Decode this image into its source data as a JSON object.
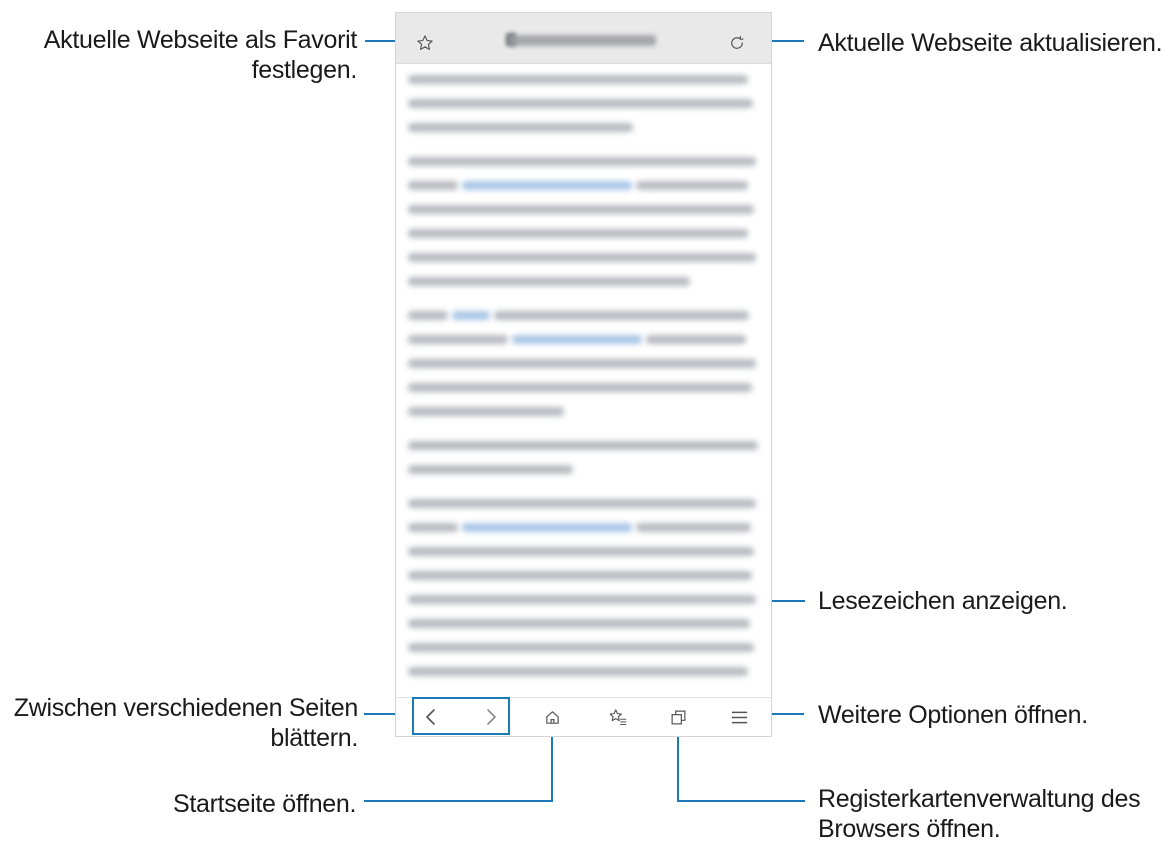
{
  "callouts": {
    "favorite": "Aktuelle Webseite als Favorit festlegen.",
    "refresh": "Aktuelle Webseite aktualisieren.",
    "bookmarks": "Lesezeichen anzeigen.",
    "navigate": "Zwischen verschiedenen Seiten blättern.",
    "more_options": "Weitere Optionen öffnen.",
    "home": "Startseite öffnen.",
    "tabs": "Registerkartenverwaltung des Browsers öffnen."
  },
  "browser": {
    "toolbar_icons": [
      "star-icon",
      "refresh-icon"
    ],
    "bottom_icons": [
      "back-icon",
      "forward-icon",
      "home-icon",
      "bookmarks-icon",
      "tabs-icon",
      "menu-icon"
    ]
  },
  "colors": {
    "accent": "#1d7ab9",
    "topbar": "#e9e9e9",
    "icon": "#555555"
  }
}
